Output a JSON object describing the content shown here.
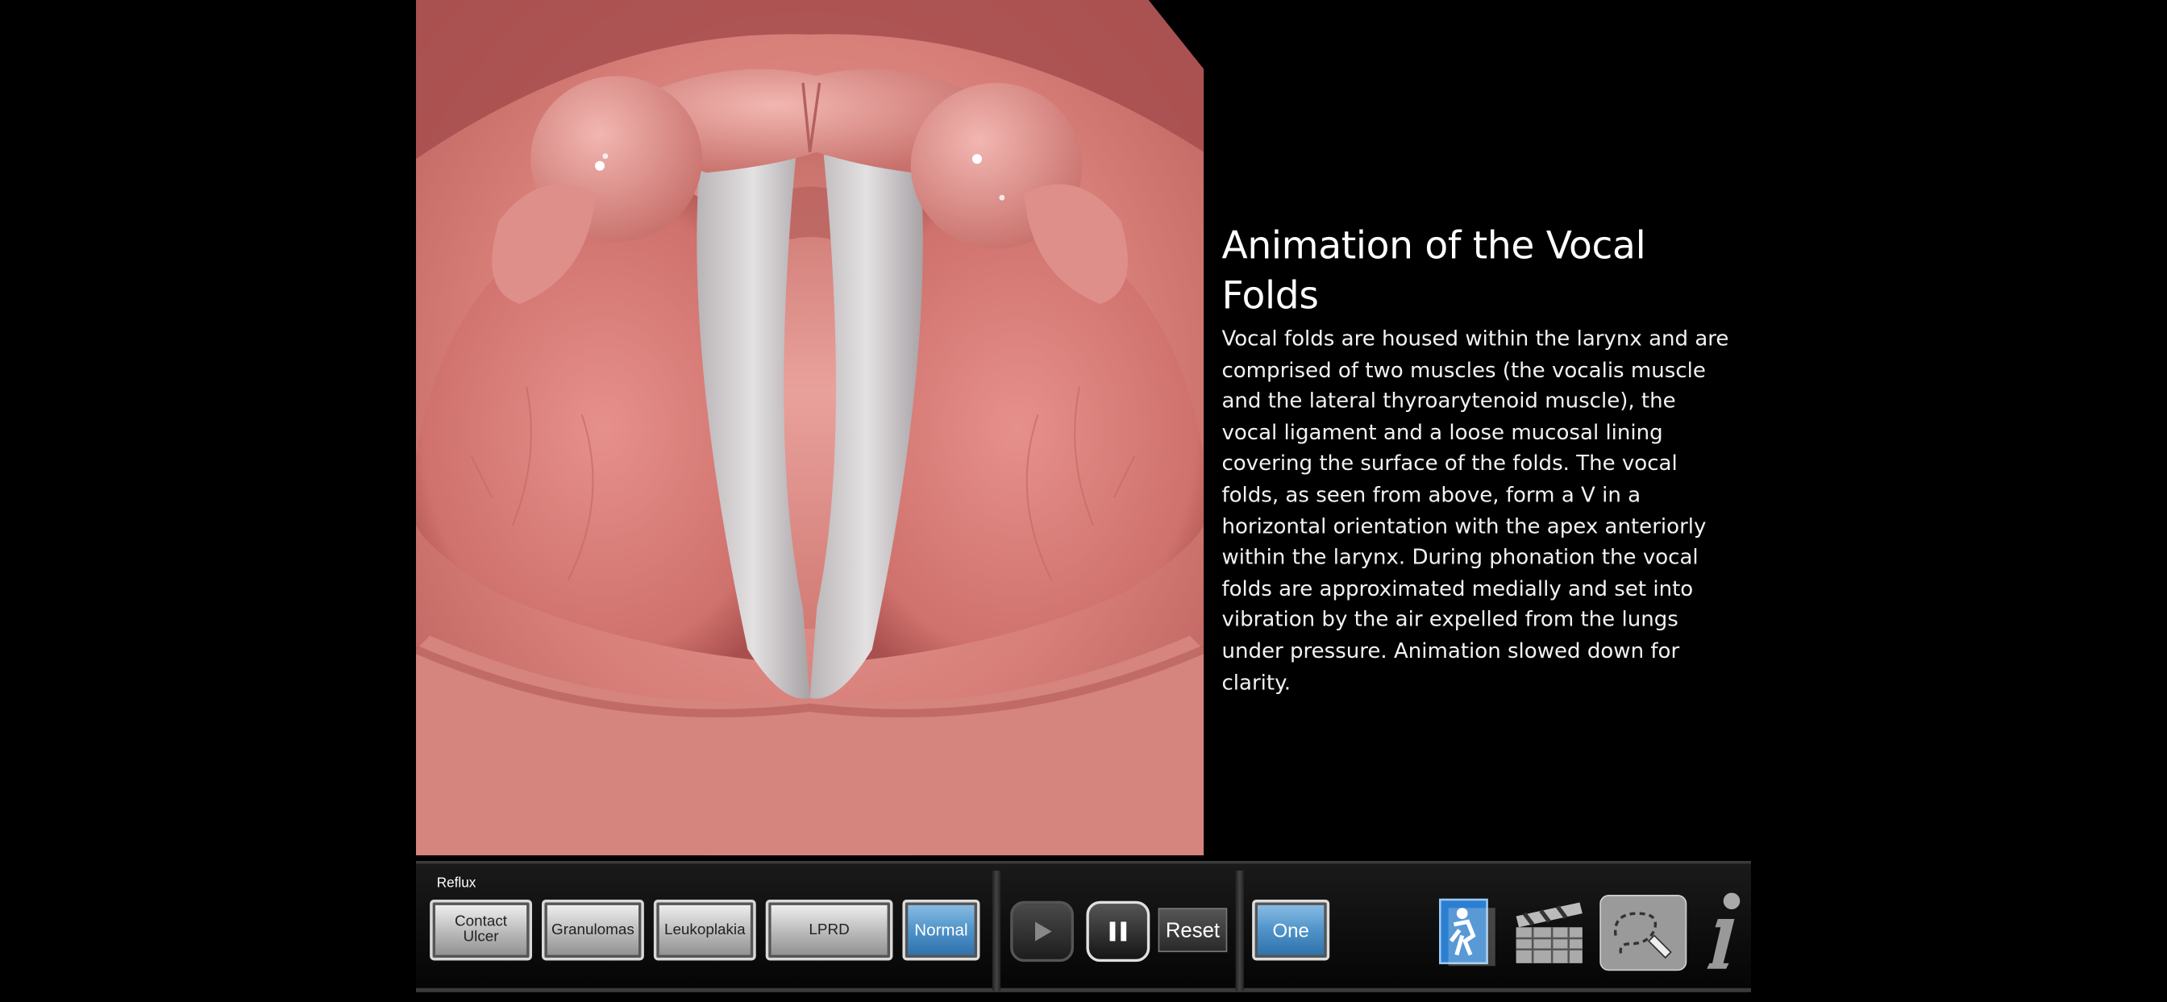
{
  "info": {
    "title": "Animation of the Vocal Folds",
    "body": "Vocal folds are housed within the larynx and are comprised of two muscles (the vocalis muscle and the lateral thyroarytenoid muscle), the vocal ligament and a loose mucosal lining covering the surface of the folds. The vocal folds, as seen from above, form a V in a horizontal orientation with the apex anteriorly within the larynx. During phonation the vocal folds are approximated medially and set into vibration by the air expelled from the lungs under pressure. Animation slowed down for clarity."
  },
  "toolbar": {
    "group_label": "Reflux",
    "conditions": {
      "contact_ulcer_line1": "Contact",
      "contact_ulcer_line2": "Ulcer",
      "granulomas": "Granulomas",
      "leukoplakia": "Leukoplakia",
      "lprd": "LPRD",
      "normal": "Normal"
    },
    "reset_label": "Reset",
    "one_label": "One"
  },
  "icons": {
    "play": "play-icon",
    "pause": "pause-icon",
    "patient": "patient-document-icon",
    "clapper": "clapperboard-icon",
    "draw": "lasso-draw-icon",
    "info": "info-icon"
  },
  "colors": {
    "tissue": "#d9807a",
    "selected": "#4f93c9",
    "background": "#000000"
  }
}
